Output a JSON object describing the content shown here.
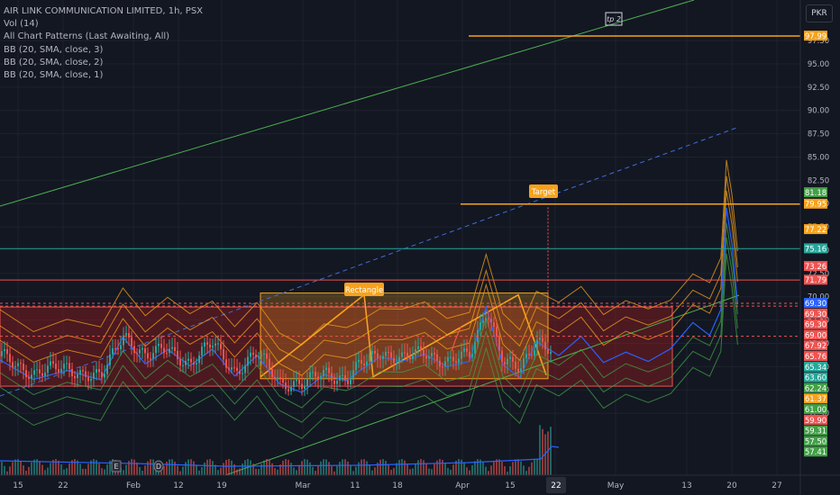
{
  "legend": {
    "symbol_line": "AIR LINK COMMUNICATION LIMITED, 1h, PSX",
    "indicators": [
      "Vol (14)",
      "All Chart Patterns (Last Awaiting, All)",
      "BB (20, SMA, close, 3)",
      "BB (20, SMA, close, 2)",
      "BB (20, SMA, close, 1)"
    ]
  },
  "currency": "PKR",
  "colors": {
    "background": "#131722",
    "grid": "#1e222d",
    "up": "#26a69a",
    "down": "#ef5350",
    "pattern": "#f7a21b",
    "zone": "#b71c1c",
    "trendline": "#4caf50",
    "projection": "#3d6fd6",
    "bb_upper": "#f7a21b",
    "bb_lower": "#43a047",
    "bb_basis": "#2962ff",
    "volume": "#2962ff"
  },
  "annotations": {
    "rectangle_label": "Rectangle",
    "target_label": "Target",
    "tp2_label": "tp 2",
    "event_markers": [
      "E",
      "D"
    ]
  },
  "chart_data": {
    "type": "candlestick",
    "y_range": [
      56.5,
      101.5
    ],
    "x_ticks": [
      "15",
      "22",
      "Feb",
      "12",
      "19",
      "Mar",
      "11",
      "18",
      "Apr",
      "15",
      "22",
      "May",
      "13",
      "20",
      "27"
    ],
    "y_ticks": [
      "97.50",
      "95.00",
      "92.50",
      "90.00",
      "87.50",
      "85.00",
      "82.50",
      "80.00",
      "77.50",
      "75.00",
      "72.50",
      "70.00",
      "67.50",
      "65.00",
      "62.50",
      "60.00",
      "57.50"
    ],
    "price_levels": [
      {
        "label": "97.99",
        "value": 97.99,
        "color": "#f7a21b"
      },
      {
        "label": "81.18",
        "value": 81.18,
        "color": "#43a047"
      },
      {
        "label": "79.95",
        "value": 79.95,
        "color": "#f7a21b"
      },
      {
        "label": "77.22",
        "value": 77.22,
        "color": "#f7a21b"
      },
      {
        "label": "75.16",
        "value": 75.16,
        "color": "#26a69a"
      },
      {
        "label": "73.26",
        "value": 73.26,
        "color": "#ef5350"
      },
      {
        "label": "71.79",
        "value": 71.79,
        "color": "#ef5350"
      },
      {
        "label": "69.30",
        "value": 69.3,
        "color": "#2962ff"
      },
      {
        "label": "69.30",
        "value": 69.3,
        "color": "#ef5350"
      },
      {
        "label": "69.30",
        "value": 69.3,
        "color": "#ef5350"
      },
      {
        "label": "69.00",
        "value": 69.0,
        "color": "#ef5350"
      },
      {
        "label": "67.92",
        "value": 67.92,
        "color": "#ef5350"
      },
      {
        "label": "65.76",
        "value": 65.76,
        "color": "#ef5350"
      },
      {
        "label": "65.34",
        "value": 65.34,
        "color": "#26a69a"
      },
      {
        "label": "63.60",
        "value": 63.6,
        "color": "#26a69a"
      },
      {
        "label": "62.24",
        "value": 62.24,
        "color": "#43a047"
      },
      {
        "label": "61.37",
        "value": 61.37,
        "color": "#f7a21b"
      },
      {
        "label": "61.00",
        "value": 61.0,
        "color": "#43a047"
      },
      {
        "label": "59.90",
        "value": 59.9,
        "color": "#ef5350"
      },
      {
        "label": "59.31",
        "value": 59.31,
        "color": "#43a047"
      },
      {
        "label": "57.50",
        "value": 57.5,
        "color": "#43a047"
      },
      {
        "label": "57.41",
        "value": 57.41,
        "color": "#43a047"
      }
    ],
    "close_path": [
      [
        0,
        63.6
      ],
      [
        0.03,
        61.8
      ],
      [
        0.06,
        62.4
      ],
      [
        0.09,
        61.2
      ],
      [
        0.11,
        66.2
      ],
      [
        0.13,
        63.4
      ],
      [
        0.15,
        64.5
      ],
      [
        0.17,
        62.8
      ],
      [
        0.19,
        65.0
      ],
      [
        0.21,
        62.0
      ],
      [
        0.23,
        63.8
      ],
      [
        0.25,
        61.0
      ],
      [
        0.27,
        60.4
      ],
      [
        0.29,
        62.0
      ],
      [
        0.31,
        61.1
      ],
      [
        0.32,
        62.4
      ],
      [
        0.34,
        64.2
      ],
      [
        0.36,
        63.3
      ],
      [
        0.38,
        64.0
      ],
      [
        0.4,
        63.1
      ],
      [
        0.42,
        63.6
      ],
      [
        0.435,
        69.0
      ],
      [
        0.45,
        63.0
      ],
      [
        0.465,
        62.0
      ],
      [
        0.48,
        65.6
      ],
      [
        0.5,
        63.8
      ],
      [
        0.52,
        66.2
      ],
      [
        0.54,
        63.6
      ],
      [
        0.56,
        64.3
      ],
      [
        0.58,
        63.2
      ],
      [
        0.6,
        65.0
      ],
      [
        0.62,
        67.8
      ],
      [
        0.635,
        66.0
      ],
      [
        0.645,
        68.9
      ],
      [
        0.65,
        80.2
      ],
      [
        0.655,
        76.0
      ],
      [
        0.66,
        69.3
      ]
    ]
  }
}
